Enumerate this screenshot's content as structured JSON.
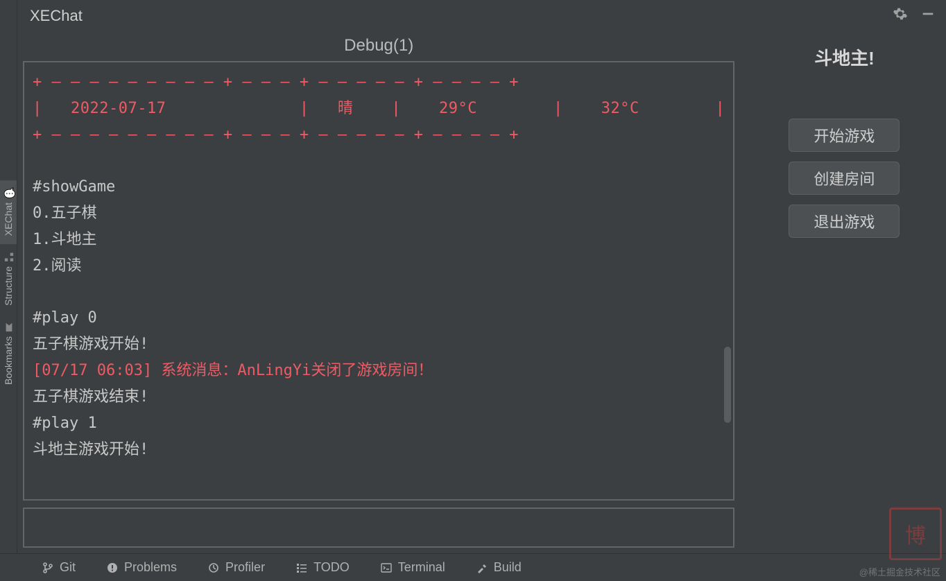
{
  "header": {
    "title": "XEChat"
  },
  "tab_title": "Debug(1)",
  "sidebar": {
    "items": [
      {
        "label": "XEChat"
      },
      {
        "label": "Structure"
      },
      {
        "label": "Bookmarks"
      }
    ]
  },
  "weather_box": {
    "top": "+ — — — — — — — — — + — — — + — — — — — + — — — — +",
    "row": "|   2022-07-17              |   晴    |    29°C        |    32°C        |",
    "bottom": "+ — — — — — — — — — + — — — + — — — — — + — — — — +"
  },
  "console": {
    "lines": [
      "",
      "#showGame",
      "0.五子棋",
      "1.斗地主",
      "2.阅读",
      "",
      "#play 0",
      "五子棋游戏开始!"
    ],
    "system_msg": "[07/17 06:03] 系统消息：AnLingYi关闭了游戏房间！",
    "lines2": [
      "五子棋游戏结束!",
      "#play 1",
      "斗地主游戏开始!"
    ]
  },
  "right_panel": {
    "title": "斗地主!",
    "buttons": [
      "开始游戏",
      "创建房间",
      "退出游戏"
    ]
  },
  "bottom": {
    "items": [
      "Git",
      "Problems",
      "Profiler",
      "TODO",
      "Terminal",
      "Build"
    ]
  },
  "watermark": "@稀土掘金技术社区"
}
